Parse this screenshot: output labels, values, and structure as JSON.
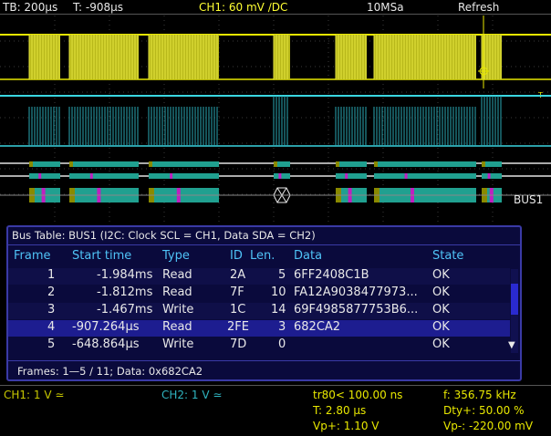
{
  "topbar": {
    "timebase": "TB: 200µs",
    "trigger_time": "T: -908µs",
    "ch1_setting": "CH1: 60 mV ∕DC",
    "sample_rate": "10MSa",
    "mode": "Refresh"
  },
  "markers": {
    "trigger_level": "T",
    "bus_label": "BUS1"
  },
  "bus_table": {
    "title": "Bus Table: BUS1 (I2C: Clock SCL = CH1, Data SDA = CH2)",
    "columns": [
      "Frame",
      "Start time",
      "Type",
      "ID",
      "Len.",
      "Data",
      "State"
    ],
    "rows": [
      {
        "frame": "1",
        "start": "-1.984ms",
        "type": "Read",
        "id": "2A",
        "len": "5",
        "data": "6FF2408C1B",
        "state": "OK",
        "selected": false
      },
      {
        "frame": "2",
        "start": "-1.812ms",
        "type": "Read",
        "id": "7F",
        "len": "10",
        "data": "FA12A9038477973...",
        "state": "OK",
        "selected": false
      },
      {
        "frame": "3",
        "start": "-1.467ms",
        "type": "Write",
        "id": "1C",
        "len": "14",
        "data": "69F4985877753B6...",
        "state": "OK",
        "selected": false
      },
      {
        "frame": "4",
        "start": "-907.264µs",
        "type": "Read",
        "id": "2FE",
        "len": "3",
        "data": "682CA2",
        "state": "OK",
        "selected": true
      },
      {
        "frame": "5",
        "start": "-648.864µs",
        "type": "Write",
        "id": "7D",
        "len": "0",
        "data": "",
        "state": "OK",
        "selected": false
      }
    ],
    "footer": "Frames: 1—5 / 11; Data: 0x682CA2",
    "scroll_down_glyph": "▼"
  },
  "bottom_status": {
    "ch1": "CH1: 1 V ≃",
    "ch2": "CH2: 1 V ≃",
    "rise_time": "tr80< 100.00 ns",
    "period": "T: 2.80 µs",
    "vp_plus": "Vp+: 1.10 V",
    "frequency": "f: 356.75 kHz",
    "duty": "Dty+: 50.00 %",
    "vp_minus": "Vp-: -220.00 mV"
  },
  "colors": {
    "ch1": "#e8e800",
    "ch2": "#3ad6e0",
    "bus_table_bg": "#0a0a3c",
    "selected_row": "#1d1d90",
    "decode_teal": "#20a090",
    "decode_magenta": "#c020c0",
    "decode_olive": "#8a8a00"
  }
}
